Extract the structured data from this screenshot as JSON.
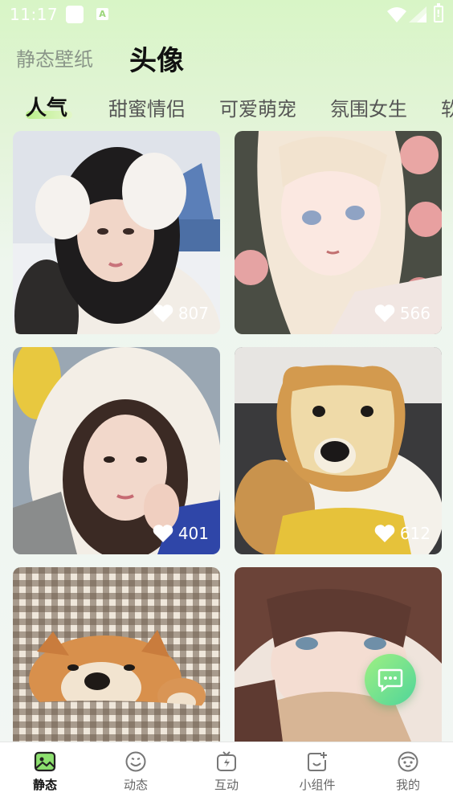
{
  "status_bar": {
    "time": "11:17"
  },
  "header": {
    "tabs": [
      {
        "label": "静态壁纸",
        "active": false
      },
      {
        "label": "头像",
        "active": true
      }
    ]
  },
  "categories": [
    "人气",
    "甜蜜情侣",
    "可爱萌宠",
    "氛围女生",
    "软"
  ],
  "grid": [
    {
      "likes": "807",
      "subject": "girl in white earmuffs in snow"
    },
    {
      "likes": "566",
      "subject": "anime girl with blonde hair and roses"
    },
    {
      "likes": "401",
      "subject": "girl in white hood"
    },
    {
      "likes": "612",
      "subject": "dog with bread face"
    },
    {
      "likes": "",
      "subject": "shiba inu dogs under checkered blanket"
    },
    {
      "likes": "",
      "subject": "anime boy with brown hair"
    }
  ],
  "bottom_nav": [
    {
      "label": "静态",
      "icon": "picture-icon",
      "active": true
    },
    {
      "label": "动态",
      "icon": "smile-icon",
      "active": false
    },
    {
      "label": "互动",
      "icon": "tv-lightning-icon",
      "active": false
    },
    {
      "label": "小组件",
      "icon": "widget-add-icon",
      "active": false
    },
    {
      "label": "我的",
      "icon": "face-icon",
      "active": false
    }
  ],
  "colors": {
    "accent": "#7ddc6a",
    "fab": "#4fd59a"
  }
}
